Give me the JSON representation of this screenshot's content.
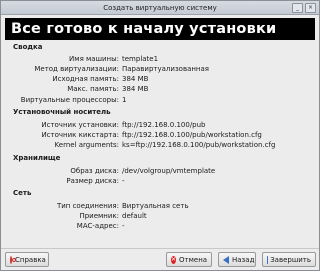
{
  "window": {
    "title": "Создать виртуальную систему"
  },
  "header": {
    "title": "Все готово к началу установки"
  },
  "sections": {
    "summary": {
      "title": "Сводка",
      "rows": [
        {
          "label": "Имя машины:",
          "value": "template1"
        },
        {
          "label": "Метод виртуализации:",
          "value": "Паравиртуализованная"
        },
        {
          "label": "Исходная память:",
          "value": "384 MB"
        },
        {
          "label": "Макс. память:",
          "value": "384 MB"
        },
        {
          "label": "Виртуальные процессоры:",
          "value": "1"
        }
      ]
    },
    "install": {
      "title": "Установочный носитель",
      "rows": [
        {
          "label": "Источник установки:",
          "value": "ftp://192.168.0.100/pub"
        },
        {
          "label": "Источник кикстарта:",
          "value": "ftp://192.168.0.100/pub/workstation.cfg"
        },
        {
          "label": "Kernel arguments:",
          "value": "ks=ftp://192.168.0.100/pub/workstation.cfg"
        }
      ]
    },
    "storage": {
      "title": "Хранилище",
      "rows": [
        {
          "label": "Образ диска:",
          "value": "/dev/volgroup/vmtemplate"
        },
        {
          "label": "Размер диска:",
          "value": "-"
        }
      ]
    },
    "network": {
      "title": "Сеть",
      "rows": [
        {
          "label": "Тип соединения:",
          "value": "Виртуальная сеть"
        },
        {
          "label": "Приемник:",
          "value": "default"
        },
        {
          "label": "MAC-адрес:",
          "value": "-"
        }
      ]
    }
  },
  "buttons": {
    "help": "Справка",
    "cancel": "Отмена",
    "back": "Назад",
    "finish": "Завершить"
  }
}
